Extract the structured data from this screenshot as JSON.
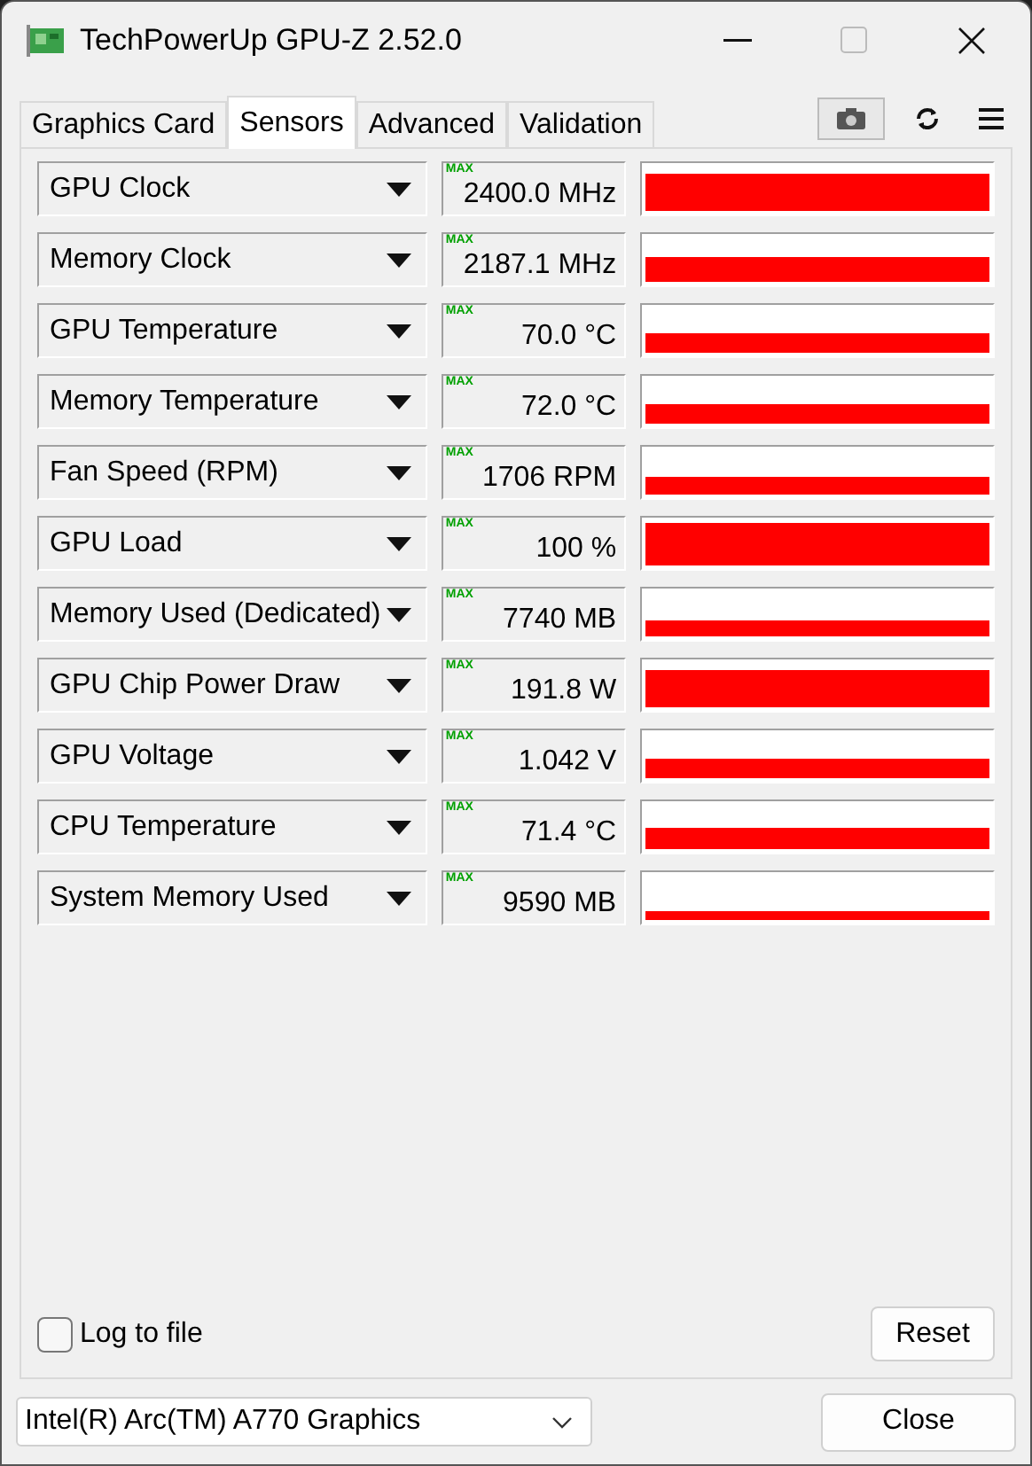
{
  "window": {
    "title": "TechPowerUp GPU-Z 2.52.0"
  },
  "tabs": [
    {
      "label": "Graphics Card",
      "selected": false
    },
    {
      "label": "Sensors",
      "selected": true
    },
    {
      "label": "Advanced",
      "selected": false
    },
    {
      "label": "Validation",
      "selected": false
    }
  ],
  "sensors": [
    {
      "name": "GPU Clock",
      "max_tag": "MAX",
      "value": "2400.0 MHz"
    },
    {
      "name": "Memory Clock",
      "max_tag": "MAX",
      "value": "2187.1 MHz"
    },
    {
      "name": "GPU Temperature",
      "max_tag": "MAX",
      "value": "70.0 °C"
    },
    {
      "name": "Memory Temperature",
      "max_tag": "MAX",
      "value": "72.0 °C"
    },
    {
      "name": "Fan Speed (RPM)",
      "max_tag": "MAX",
      "value": "1706 RPM"
    },
    {
      "name": "GPU Load",
      "max_tag": "MAX",
      "value": "100 %"
    },
    {
      "name": "Memory Used (Dedicated)",
      "max_tag": "MAX",
      "value": "7740 MB"
    },
    {
      "name": "GPU Chip Power Draw",
      "max_tag": "MAX",
      "value": "191.8 W"
    },
    {
      "name": "GPU Voltage",
      "max_tag": "MAX",
      "value": "1.042 V"
    },
    {
      "name": "CPU Temperature",
      "max_tag": "MAX",
      "value": "71.4 °C"
    },
    {
      "name": "System Memory Used",
      "max_tag": "MAX",
      "value": "9590 MB"
    }
  ],
  "log_to_file": {
    "label": "Log to file",
    "checked": false
  },
  "reset_button": "Reset",
  "device_select": {
    "value": "Intel(R) Arc(TM) A770 Graphics"
  },
  "close_button": "Close"
}
